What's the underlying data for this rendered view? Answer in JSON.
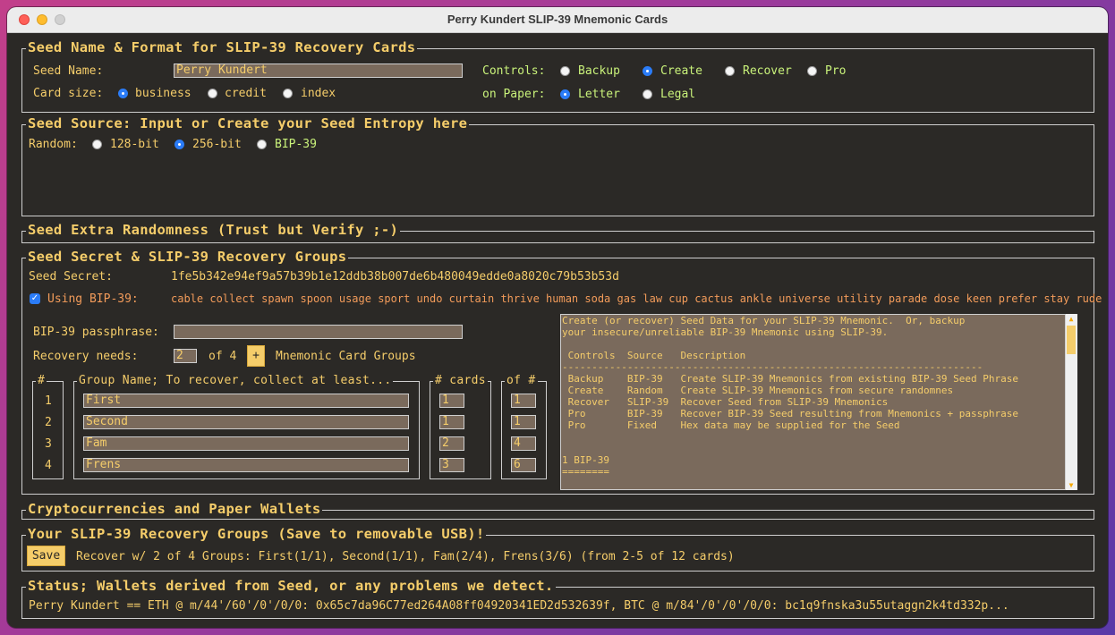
{
  "window": {
    "title": "Perry Kundert SLIP-39 Mnemonic Cards"
  },
  "seed_name_section": {
    "legend": "Seed Name & Format for SLIP-39 Recovery Cards",
    "seed_name_label": "Seed Name:",
    "seed_name_value": "Perry Kundert",
    "card_size_label": "Card size:",
    "card_sizes": [
      {
        "label": "business",
        "selected": true
      },
      {
        "label": "credit",
        "selected": false
      },
      {
        "label": "index",
        "selected": false
      }
    ],
    "controls_label": "Controls:",
    "controls": [
      {
        "label": "Backup",
        "selected": false
      },
      {
        "label": "Create",
        "selected": true
      },
      {
        "label": "Recover",
        "selected": false
      },
      {
        "label": "Pro",
        "selected": false
      }
    ],
    "paper_label": "on Paper:",
    "papers": [
      {
        "label": "Letter",
        "selected": true
      },
      {
        "label": "Legal",
        "selected": false
      }
    ]
  },
  "seed_source_section": {
    "legend": "Seed Source: Input or Create your Seed Entropy here",
    "random_label": "Random:",
    "options": [
      {
        "label": "128-bit",
        "selected": false
      },
      {
        "label": "256-bit",
        "selected": true
      },
      {
        "label": "BIP-39",
        "selected": false
      }
    ]
  },
  "extra_randomness_section": {
    "legend": "Seed Extra Randomness (Trust but Verify ;-)"
  },
  "secret_section": {
    "legend": "Seed Secret & SLIP-39 Recovery Groups",
    "seed_secret_label": "Seed Secret:",
    "seed_secret_value": "1fe5b342e94ef9a57b39b1e12ddb38b007de6b480049edde0a8020c79b53b53d",
    "using_bip39_label": "Using BIP-39:",
    "using_bip39_checked": true,
    "bip39_words": "cable collect spawn spoon usage sport undo curtain thrive human soda gas law cup cactus ankle universe utility parade dose keen prefer stay rude",
    "passphrase_label": "BIP-39 passphrase:",
    "passphrase_value": "",
    "recovery_needs_label": "Recovery needs:",
    "recovery_needs_value": "2",
    "of_label": "of 4",
    "plus_label": "+",
    "groups_label": "Mnemonic Card Groups",
    "col_index_header": "#",
    "col_name_header": "Group Name; To recover, collect at least...",
    "col_cards_header": "# cards",
    "col_of_header": "of #",
    "groups": [
      {
        "index": "1",
        "name": "First",
        "needed": "1",
        "of": "1"
      },
      {
        "index": "2",
        "name": "Second",
        "needed": "1",
        "of": "1"
      },
      {
        "index": "3",
        "name": "Fam",
        "needed": "2",
        "of": "4"
      },
      {
        "index": "4",
        "name": "Frens",
        "needed": "3",
        "of": "6"
      }
    ],
    "info_text": "Create (or recover) Seed Data for your SLIP-39 Mnemonic.  Or, backup\nyour insecure/unreliable BIP-39 Mnemonic using SLIP-39.\n\n Controls  Source   Description\n-----------------------------------------------------------------------\n Backup    BIP-39   Create SLIP-39 Mnemonics from existing BIP-39 Seed Phrase\n Create    Random   Create SLIP-39 Mnemonics from secure randomnes\n Recover   SLIP-39  Recover Seed from SLIP-39 Mnemonics\n Pro       BIP-39   Recover BIP-39 Seed resulting from Mnemonics + passphrase\n Pro       Fixed    Hex data may be supplied for the Seed\n\n\n1 BIP-39\n========"
  },
  "crypto_section": {
    "legend": "Cryptocurrencies and Paper Wallets"
  },
  "groups_section": {
    "legend": "Your SLIP-39 Recovery Groups (Save to removable USB)!",
    "save_label": "Save",
    "summary": "Recover w/ 2 of 4 Groups: First(1/1), Second(1/1), Fam(2/4), Frens(3/6) (from 2-5 of 12 cards)"
  },
  "status_section": {
    "legend": "Status; Wallets derived from Seed, or any problems we detect.",
    "status_text": "Perry Kundert == ETH @ m/44'/60'/0'/0/0: 0x65c7da96C77ed264A08ff04920341ED2d532639f, BTC @ m/84'/0'/0'/0/0: bc1q9fnska3u55utaggn2k4td332p..."
  },
  "colors": {
    "accent": "#f5cd6a",
    "green_text": "#c9f27a",
    "orange_text": "#f29b5a",
    "background": "#2b2926"
  }
}
